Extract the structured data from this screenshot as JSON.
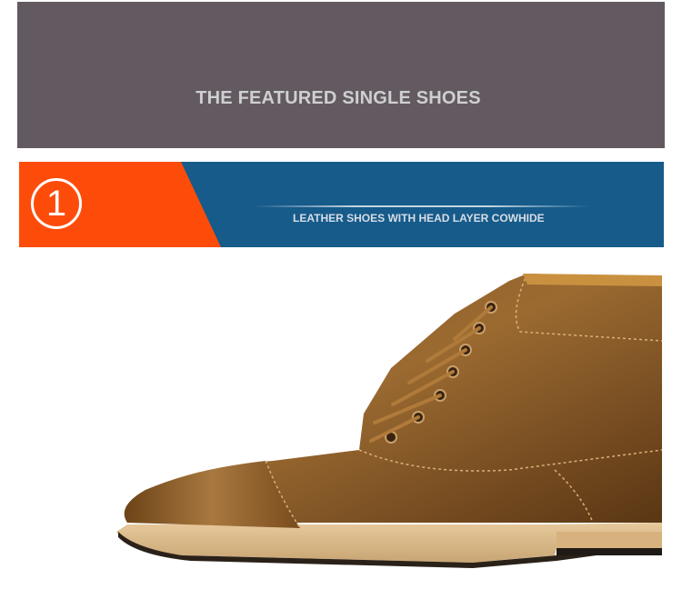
{
  "header": {
    "title": "THE FEATURED SINGLE SHOES",
    "background_color": "#625a60"
  },
  "section": {
    "number": "1",
    "subtitle": "LEATHER SHOES WITH HEAD LAYER COWHIDE",
    "accent_color": "#fd4c0a",
    "bar_color": "#165b8a"
  },
  "product": {
    "image_name": "brown-leather-cap-toe-ankle-boot"
  }
}
